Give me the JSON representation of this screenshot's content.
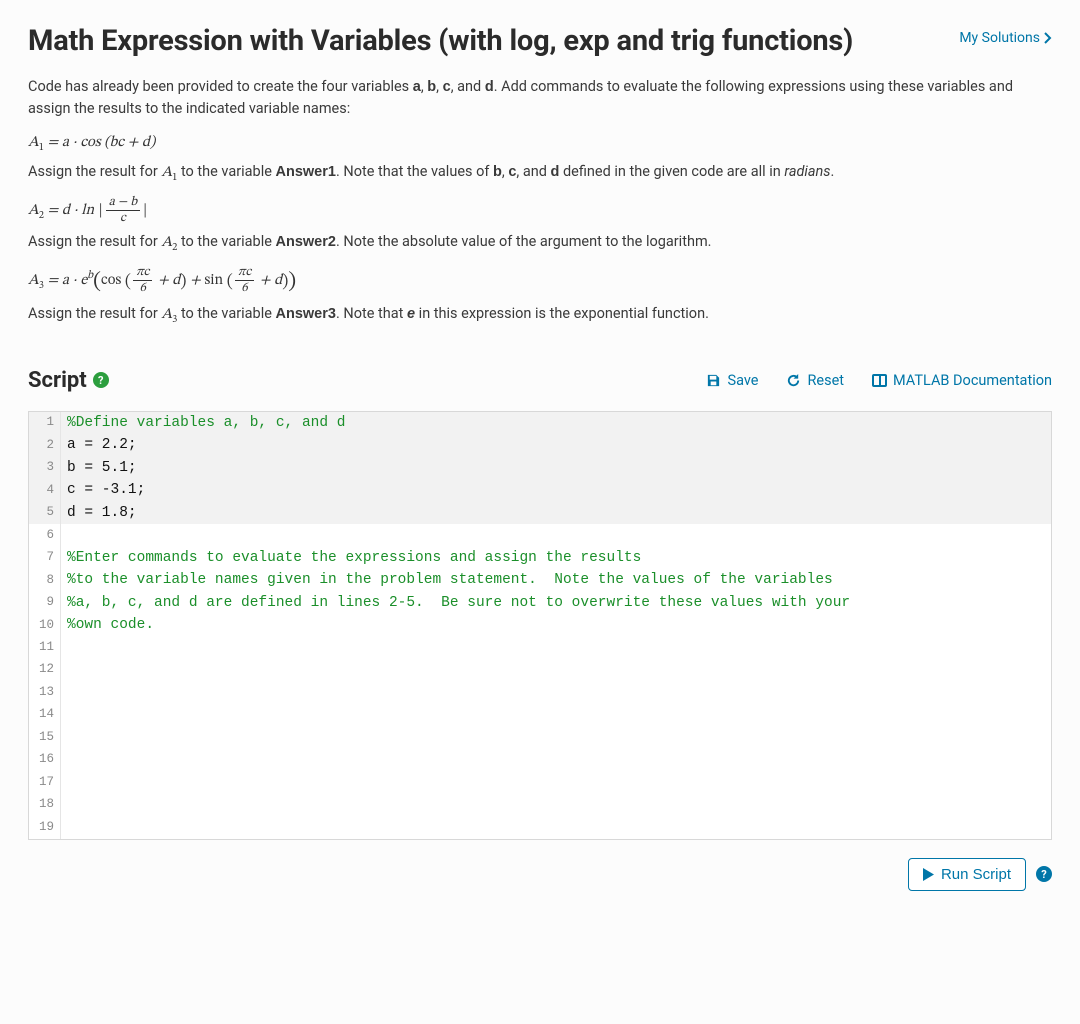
{
  "header": {
    "title": "Math Expression with Variables (with log, exp and trig functions)",
    "my_solutions": "My Solutions"
  },
  "intro": {
    "p1a": "Code has already been provided to create the four variables ",
    "p1b": ".  Add commands to evaluate the following expressions using these variables and assign the results to the indicated variable names:",
    "vars": {
      "a": "a",
      "b": "b",
      "c": "c",
      "d": "d",
      "and": "and",
      "comma": ", "
    }
  },
  "eq1": {
    "lhs": "A",
    "sub": "1",
    "rhs_a": " = a · cos (bc + d)"
  },
  "assign1": {
    "pre": "Assign the result for ",
    "sym": "A",
    "sub": "1",
    "mid": " to the variable ",
    "var": "Answer1",
    "post_a": ". Note that the values of ",
    "post_b": " defined in the given code are all in ",
    "radians": "radians",
    "dot": "."
  },
  "eq2": {
    "lhs": "A",
    "sub": "2",
    "pre": " = d · ln ",
    "num": "a − b",
    "den": "c"
  },
  "assign2": {
    "pre": "Assign the result for ",
    "sym": "A",
    "sub": "2",
    "mid": " to the variable ",
    "var": "Answer2",
    "post": ". Note the absolute value of the argument to the logarithm."
  },
  "eq3": {
    "lhs": "A",
    "sub": "3",
    "pre": " = a · e",
    "sup": "b",
    "cos": "cos ",
    "plus_d1": " + d",
    "plus": " + ",
    "sin": "sin ",
    "plus_d2": " + d",
    "pi_c_num": "πc",
    "six": "6"
  },
  "assign3": {
    "pre": "Assign the result for ",
    "sym": "A",
    "sub": "3",
    "mid": " to the variable ",
    "var": "Answer3",
    "post_a": ". Note that ",
    "e": "e",
    "post_b": " in this expression is the exponential function."
  },
  "script_header": {
    "title": "Script",
    "save": "Save",
    "reset": "Reset",
    "doc": "MATLAB Documentation"
  },
  "code": {
    "lines": [
      {
        "n": "1",
        "hl": true,
        "text": "%Define variables a, b, c, and d",
        "comment": true
      },
      {
        "n": "2",
        "hl": true,
        "text": "a = 2.2;"
      },
      {
        "n": "3",
        "hl": true,
        "text": "b = 5.1;"
      },
      {
        "n": "4",
        "hl": true,
        "text": "c = -3.1;"
      },
      {
        "n": "5",
        "hl": true,
        "text": "d = 1.8;"
      },
      {
        "n": "6",
        "hl": false,
        "text": ""
      },
      {
        "n": "7",
        "hl": false,
        "text": "%Enter commands to evaluate the expressions and assign the results",
        "comment": true
      },
      {
        "n": "8",
        "hl": false,
        "text": "%to the variable names given in the problem statement.  Note the values of the variables",
        "comment": true
      },
      {
        "n": "9",
        "hl": false,
        "text": "%a, b, c, and d are defined in lines 2-5.  Be sure not to overwrite these values with your",
        "comment": true
      },
      {
        "n": "10",
        "hl": false,
        "text": "%own code.",
        "comment": true
      },
      {
        "n": "11",
        "hl": false,
        "text": ""
      },
      {
        "n": "12",
        "hl": false,
        "text": ""
      },
      {
        "n": "13",
        "hl": false,
        "text": ""
      },
      {
        "n": "14",
        "hl": false,
        "text": ""
      },
      {
        "n": "15",
        "hl": false,
        "text": ""
      },
      {
        "n": "16",
        "hl": false,
        "text": ""
      },
      {
        "n": "17",
        "hl": false,
        "text": ""
      },
      {
        "n": "18",
        "hl": false,
        "text": ""
      },
      {
        "n": "19",
        "hl": false,
        "text": ""
      }
    ]
  },
  "footer": {
    "run": "Run Script"
  }
}
